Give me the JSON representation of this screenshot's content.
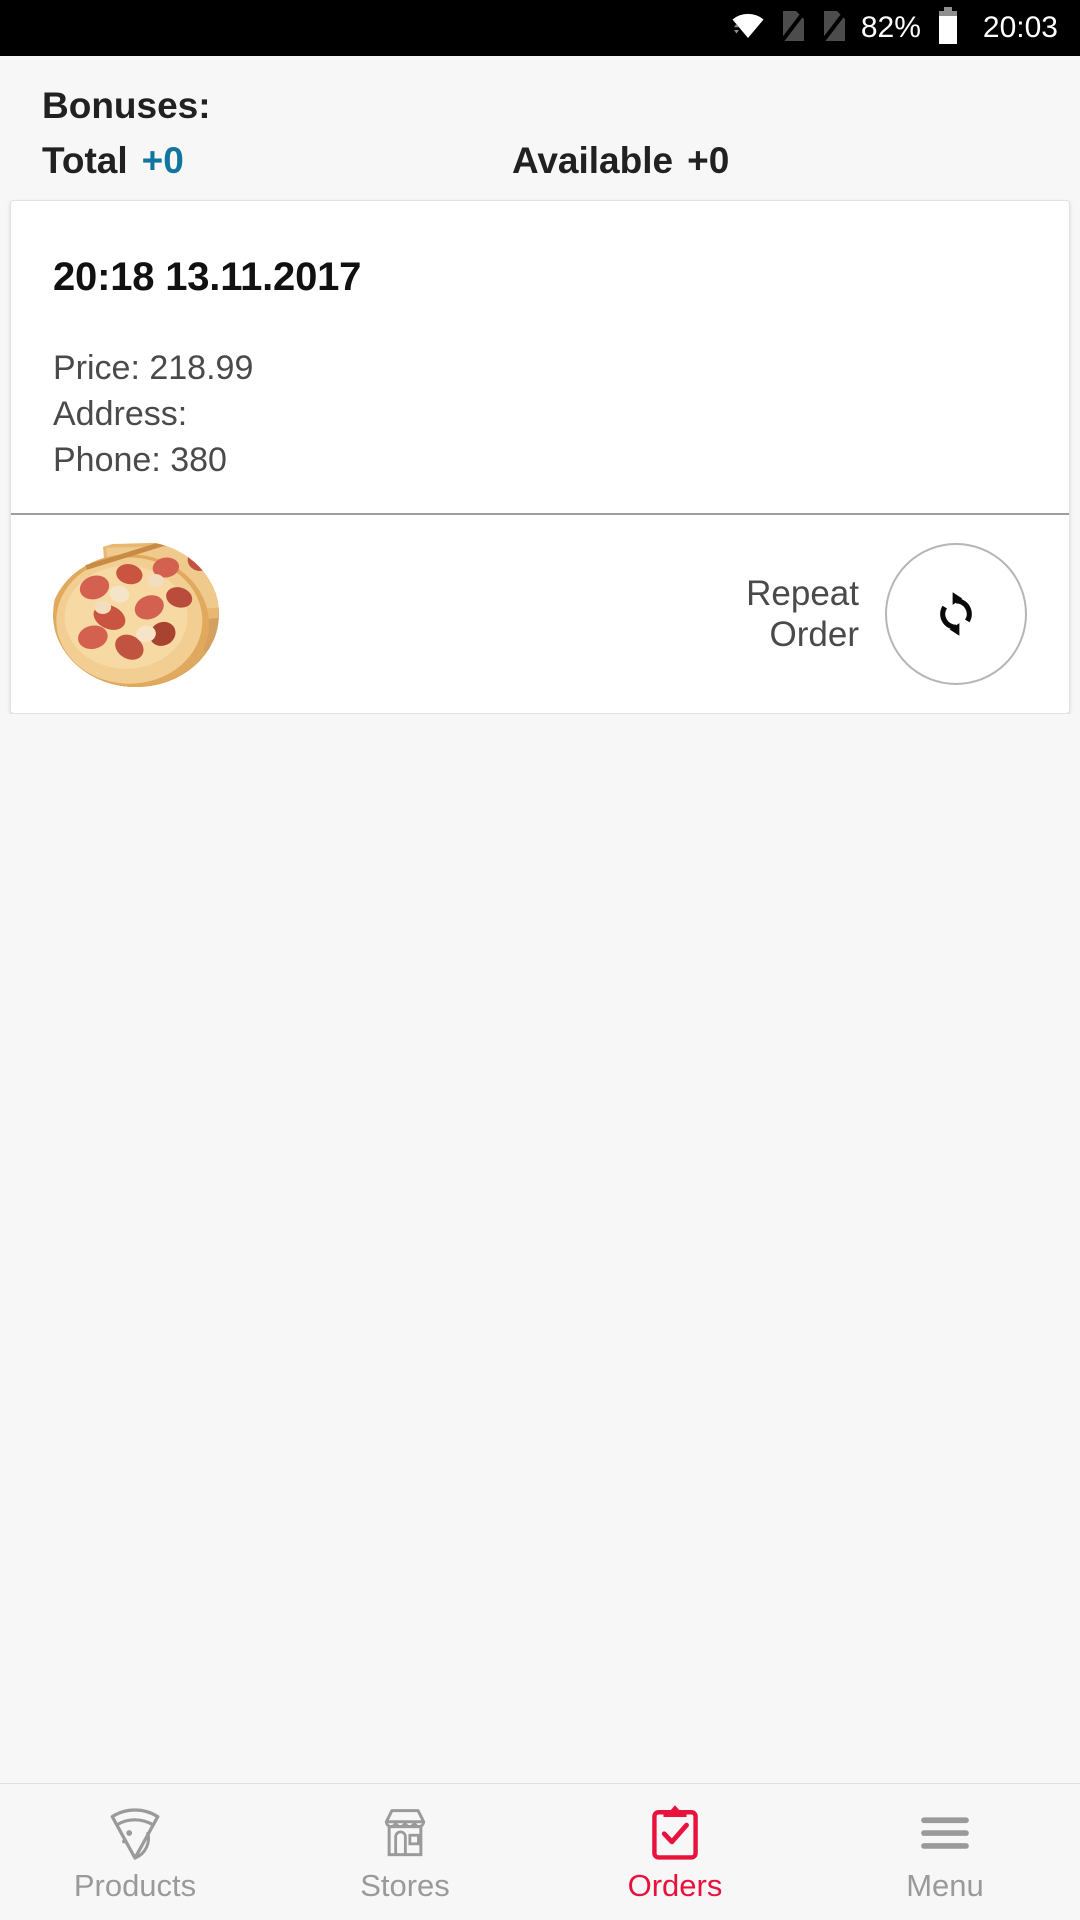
{
  "status_bar": {
    "wifi_icon": "wifi-icon",
    "sim1_icon": "sim-card-disabled-icon",
    "sim2_icon": "sim-card-disabled-icon",
    "battery_percent": "82%",
    "battery_icon": "battery-full-icon",
    "clock": "20:03",
    "background_color": "#000000",
    "text_color": "#ffffff"
  },
  "bonuses": {
    "title": "Bonuses:",
    "total_label": "Total",
    "total_value": "+0",
    "total_value_color": "#11769e",
    "available_label": "Available",
    "available_value": "+0",
    "available_value_color": "#212121"
  },
  "order_card": {
    "datetime": "20:18 13.11.2017",
    "price_line": "Price: 218.99",
    "address_line": "Address:",
    "phone_line": "Phone: 380",
    "thumbnail_icon": "pizza-thumbnail-image",
    "repeat_label": "Repeat\nOrder",
    "repeat_icon": "refresh-sync-icon"
  },
  "bottom_nav": {
    "active_color": "#e8123c",
    "inactive_color": "#9a9a9a",
    "items": [
      {
        "label": "Products",
        "icon": "pizza-slice-icon",
        "active": false
      },
      {
        "label": "Stores",
        "icon": "storefront-icon",
        "active": false
      },
      {
        "label": "Orders",
        "icon": "clipboard-check-icon",
        "active": true
      },
      {
        "label": "Menu",
        "icon": "hamburger-menu-icon",
        "active": false
      }
    ]
  }
}
